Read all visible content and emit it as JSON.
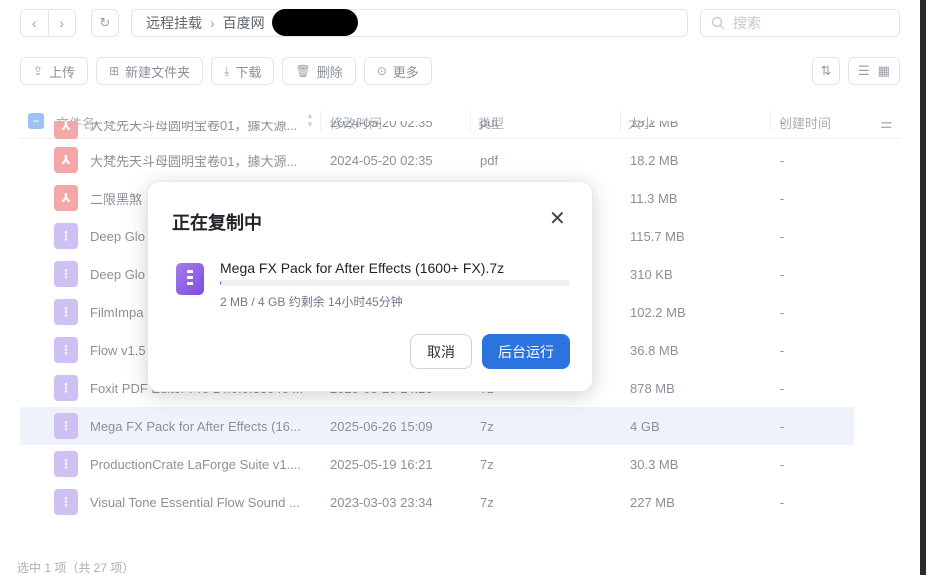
{
  "nav": {
    "back_icon": "chevron-left-icon",
    "forward_icon": "chevron-right-icon",
    "refresh_icon": "refresh-icon",
    "breadcrumb": [
      "远程挂载",
      "百度网"
    ],
    "search_placeholder": "搜索"
  },
  "toolbar": {
    "upload_label": "上传",
    "new_folder_label": "新建文件夹",
    "download_label": "下载",
    "delete_label": "删除",
    "more_label": "更多"
  },
  "table": {
    "headers": {
      "name": "文件名",
      "modified": "修改时间",
      "type": "类型",
      "size": "大小",
      "created": "创建时间"
    },
    "rows": [
      {
        "name": "大梵先天斗母圆明宝卷01，據大源...",
        "date": "2024-05-20 02:35",
        "type": "pdf",
        "size": "18.2 MB",
        "created": "-",
        "icon": "pdf",
        "selected": false
      },
      {
        "name": "大梵先天斗母圆明宝卷01，據大源...",
        "date": "2024-05-20 02:35",
        "type": "pdf",
        "size": "18.2 MB",
        "created": "-",
        "icon": "pdf",
        "selected": false
      },
      {
        "name": "二限黑煞",
        "date": "",
        "type": "",
        "size": "11.3 MB",
        "created": "-",
        "icon": "pdf",
        "selected": false
      },
      {
        "name": "Deep Glo",
        "date": "",
        "type": "",
        "size": "115.7 MB",
        "created": "-",
        "icon": "zip",
        "selected": false
      },
      {
        "name": "Deep Glo",
        "date": "",
        "type": "",
        "size": "310 KB",
        "created": "-",
        "icon": "zip",
        "selected": false
      },
      {
        "name": "FilmImpa",
        "date": "",
        "type": "",
        "size": "102.2 MB",
        "created": "-",
        "icon": "zip",
        "selected": false
      },
      {
        "name": "Flow v1.5",
        "date": "",
        "type": "",
        "size": "36.8 MB",
        "created": "-",
        "icon": "zip",
        "selected": false
      },
      {
        "name": "Foxit PDF Editor Pro 14.0.0.33046 ...",
        "date": "2025-08-20 14:26",
        "type": "7z",
        "size": "878 MB",
        "created": "-",
        "icon": "zip",
        "selected": false
      },
      {
        "name": "Mega FX Pack for After Effects (16...",
        "date": "2025-06-26 15:09",
        "type": "7z",
        "size": "4 GB",
        "created": "-",
        "icon": "zip",
        "selected": true
      },
      {
        "name": "ProductionCrate LaForge Suite v1....",
        "date": "2025-05-19 16:21",
        "type": "7z",
        "size": "30.3 MB",
        "created": "-",
        "icon": "zip",
        "selected": false
      },
      {
        "name": "Visual Tone Essential Flow Sound ...",
        "date": "2023-03-03 23:34",
        "type": "7z",
        "size": "227 MB",
        "created": "-",
        "icon": "zip",
        "selected": false
      }
    ]
  },
  "status_text": "选中 1 项（共 27 项）",
  "modal": {
    "title": "正在复制中",
    "close_icon": "close-icon",
    "file_icon": "zip-archive-icon",
    "filename": "Mega FX Pack for After Effects (1600+ FX).7z",
    "progress_fraction": 0.0005,
    "progress_text": "2 MB / 4 GB 约剩余 14小时45分钟",
    "cancel_label": "取消",
    "background_label": "后台运行",
    "accent_color": "#2b74e0"
  }
}
